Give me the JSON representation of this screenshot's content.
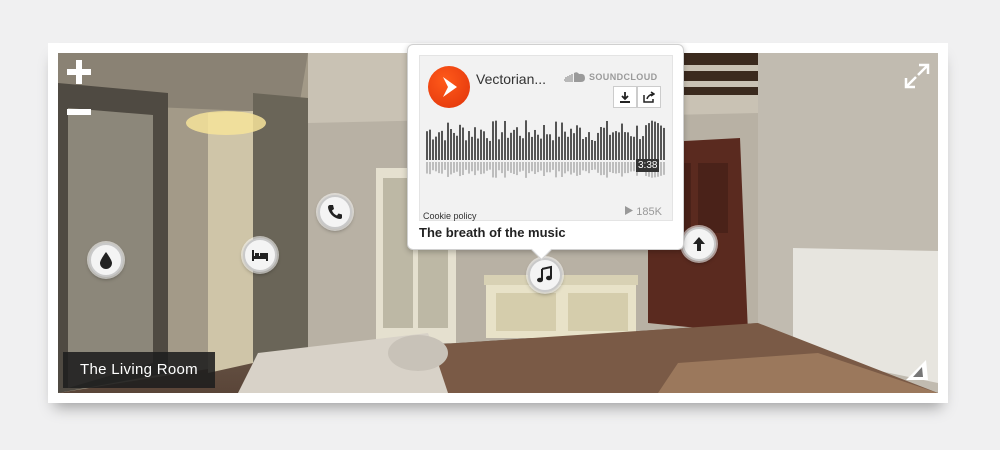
{
  "tour": {
    "room_name": "The Living Room",
    "zoom_in_label": "+",
    "zoom_out_label": "−",
    "fullscreen_icon": "expand-icon",
    "gyro_icon": "triangle-compass-icon"
  },
  "hotspots": [
    {
      "name": "water-drop",
      "icon": "drop-icon"
    },
    {
      "name": "bedroom",
      "icon": "bed-icon"
    },
    {
      "name": "phone",
      "icon": "phone-icon"
    },
    {
      "name": "music",
      "icon": "music-note-icon"
    },
    {
      "name": "navigate-up",
      "icon": "arrow-up-icon"
    }
  ],
  "popup": {
    "title": "The breath of the music",
    "player": {
      "track_title": "Vectorian...",
      "brand": "SOUNDCLOUD",
      "duration": "3:38",
      "plays": "185K",
      "cookie_policy": "Cookie policy",
      "accent_color": "#f3480f"
    }
  }
}
